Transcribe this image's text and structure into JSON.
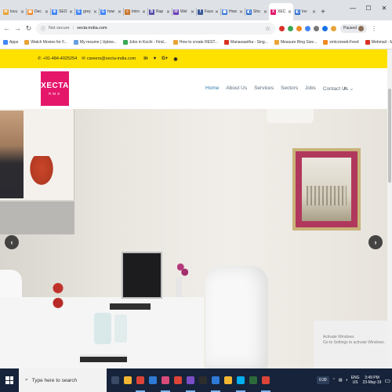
{
  "browser": {
    "tabs": [
      {
        "label": "locu",
        "color": "#e8a33a",
        "glyph": "✉"
      },
      {
        "label": "Dec",
        "color": "#f08a24",
        "glyph": "▣"
      },
      {
        "label": "SEO",
        "color": "#4285f4",
        "glyph": "⚙"
      },
      {
        "label": "grey",
        "color": "#4285f4",
        "glyph": "G"
      },
      {
        "label": "how",
        "color": "#4285f4",
        "glyph": "G"
      },
      {
        "label": "Intro",
        "color": "#c8772d",
        "glyph": "≡"
      },
      {
        "label": "Rap",
        "color": "#5b4ea8",
        "glyph": "B"
      },
      {
        "label": "Wel",
        "color": "#6a3fb5",
        "glyph": "W"
      },
      {
        "label": "Face",
        "color": "#3b5998",
        "glyph": "f"
      },
      {
        "label": "How",
        "color": "#3d7bd9",
        "glyph": "▦"
      },
      {
        "label": "Sho",
        "color": "#2f6ecf",
        "glyph": "◧"
      },
      {
        "label": "XEC",
        "color": "#e5176b",
        "glyph": "X"
      },
      {
        "label": "Inv",
        "color": "#2f6ecf",
        "glyph": "◧"
      }
    ],
    "active_tab": 11,
    "new_tab": "+",
    "window_controls": {
      "minimize": "—",
      "maximize": "☐",
      "close": "✕"
    },
    "url": {
      "status": "Not secure",
      "address": "xecta-india.com"
    },
    "profile": {
      "label": "Paused"
    },
    "bookmarks": [
      {
        "label": "Apps",
        "color": "#4285f4"
      },
      {
        "label": "Watch Movies for F...",
        "color": "#e8a33a"
      },
      {
        "label": "My resume | Uptow...",
        "color": "#6b9ee0"
      },
      {
        "label": "Jobs in Kochi - Find...",
        "color": "#3aa757"
      },
      {
        "label": "How to create REST...",
        "color": "#e8a33a"
      },
      {
        "label": "Manavaartha - Sing...",
        "color": "#d93025"
      },
      {
        "label": "Measure Ring Size...",
        "color": "#e8a33a"
      },
      {
        "label": "smtcorweb-Feed",
        "color": "#f08a24"
      },
      {
        "label": "Webmail - Main",
        "color": "#d93025"
      }
    ]
  },
  "site": {
    "phone": "+91-484-4025254",
    "email": "careers@xecta-india.com",
    "social": [
      "in",
      "♥",
      "G+",
      "◉"
    ],
    "logo": {
      "line1": "XECTA",
      "line2": "RMS"
    },
    "nav": [
      "Home",
      "About Us",
      "Services",
      "Sectors",
      "Jobs",
      "Contact Us ⌄"
    ],
    "slider": {
      "prev": "‹",
      "next": "›"
    }
  },
  "watermark": {
    "line1": "Activate Windows",
    "line2": "Go to Settings to activate Windows."
  },
  "taskbar": {
    "search_placeholder": "Type here to search",
    "apps": [
      {
        "name": "task-view",
        "color": "#3a4a66"
      },
      {
        "name": "file-explorer",
        "color": "#f2b632"
      },
      {
        "name": "chrome",
        "color": "#db4437"
      },
      {
        "name": "mail",
        "color": "#2f7ad6"
      },
      {
        "name": "photos",
        "color": "#d94c7a"
      },
      {
        "name": "chrome",
        "color": "#db4437"
      },
      {
        "name": "vs",
        "color": "#7b4ec8"
      },
      {
        "name": "terminal",
        "color": "#2d2d2d"
      },
      {
        "name": "app",
        "color": "#2f7ad6"
      },
      {
        "name": "folder",
        "color": "#f2b632"
      },
      {
        "name": "skype",
        "color": "#00aff0"
      },
      {
        "name": "app",
        "color": "#2d6a3a"
      },
      {
        "name": "chrome",
        "color": "#db4437"
      }
    ],
    "tray": {
      "recording": "0:39",
      "lang1": "ENG",
      "lang2": "US",
      "time": "3:49 PM",
      "date": "23-May-19"
    }
  }
}
